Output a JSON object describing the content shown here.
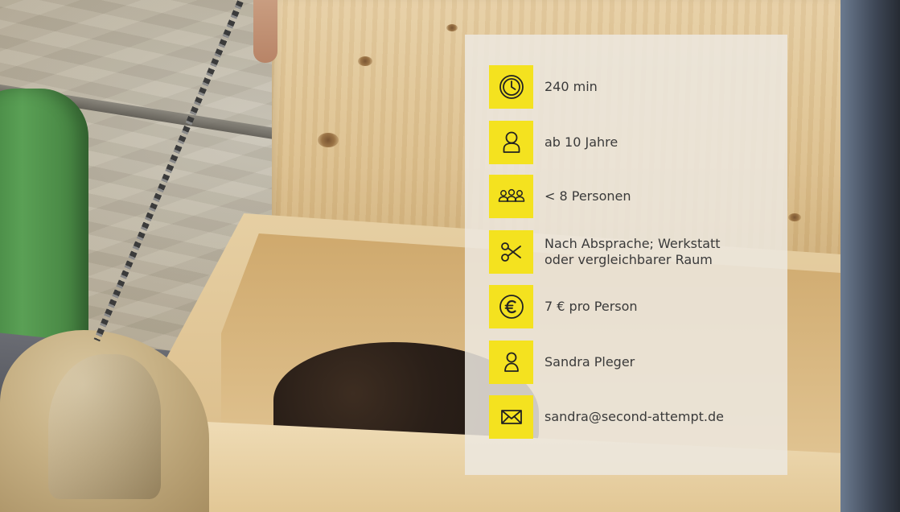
{
  "card": {
    "accent_color": "#f4e21f",
    "items": [
      {
        "icon": "clock-icon",
        "label": "240 min"
      },
      {
        "icon": "person-icon",
        "label": "ab 10 Jahre"
      },
      {
        "icon": "group-icon",
        "label": "< 8 Personen"
      },
      {
        "icon": "scissors-icon",
        "label": "Nach Absprache; Werkstatt\noder vergleichbarer Raum"
      },
      {
        "icon": "euro-icon",
        "label": "7 € pro Person"
      },
      {
        "icon": "contact-person-icon",
        "label": "Sandra Pleger"
      },
      {
        "icon": "envelope-icon",
        "label": "sandra@second-attempt.de"
      }
    ]
  }
}
